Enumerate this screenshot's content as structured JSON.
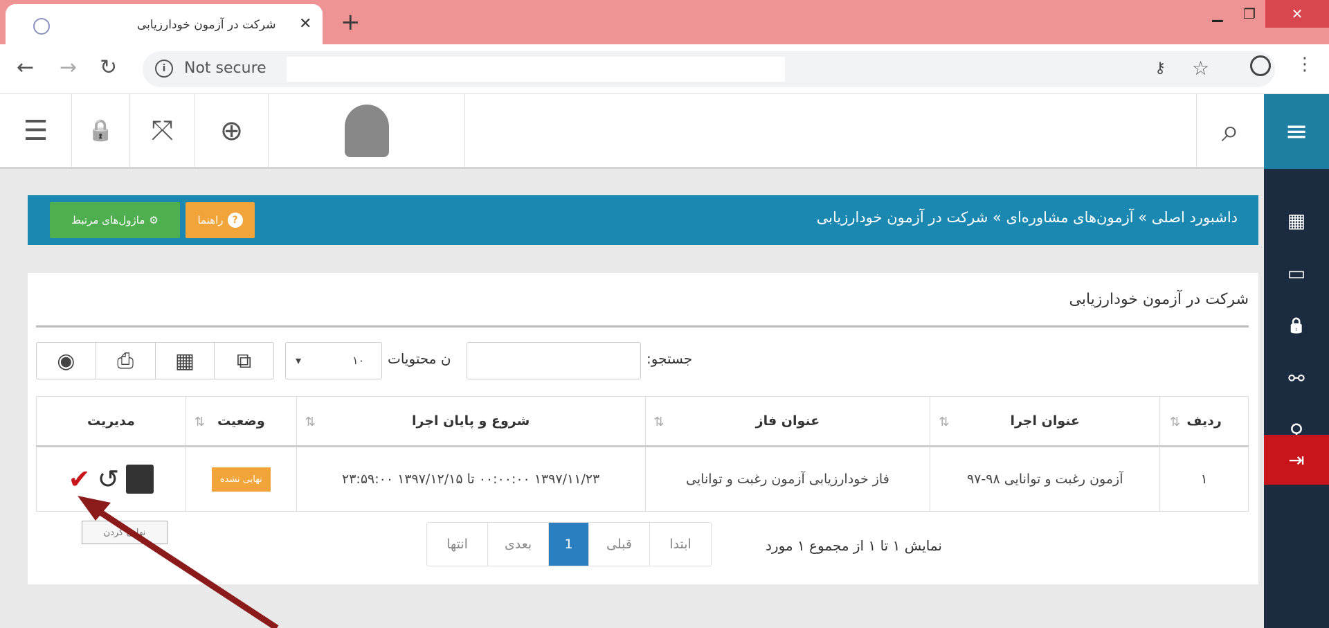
{
  "browser": {
    "tab_title": "شرکت در آزمون خودارزیابی",
    "tab_close": "✕",
    "new_tab": "+",
    "win_min": "▁",
    "win_max": "❐",
    "win_close": "✕",
    "nav_back": "←",
    "nav_forward": "→",
    "nav_reload": "↻",
    "info_glyph": "i",
    "security_text": "Not secure",
    "key_glyph": "⚷",
    "star_glyph": "☆",
    "menu_glyph": "⋮"
  },
  "header": {
    "icons": [
      "list-icon",
      "lock-icon",
      "fullscreen-icon",
      "help-lifebuoy-icon",
      "avatar",
      "search-icon"
    ],
    "list_glyph": "☰",
    "lock_glyph": "🔒",
    "fullscreen_glyph": "⤧",
    "help_glyph": "⊕",
    "search_glyph": "⌕"
  },
  "sidebar": {
    "menu_glyph": "≡",
    "items": [
      {
        "icon": "grid-icon",
        "glyph": "▦"
      },
      {
        "icon": "monitor-icon",
        "glyph": "▭"
      },
      {
        "icon": "lock-icon",
        "glyph": "🔒"
      },
      {
        "icon": "link-icon",
        "glyph": "⚯"
      },
      {
        "icon": "bulb-icon",
        "glyph": "♀"
      },
      {
        "icon": "exit-icon",
        "glyph": "⇥"
      }
    ],
    "exit_color": "#c8151b"
  },
  "breadcrumb": {
    "text": "داشبورد اصلی » آزمون‌های مشاوره‌ای » شرکت در آزمون خودارزیابی",
    "help_label": "راهنما",
    "help_glyph": "?",
    "modules_label": "ماژول‌های مرتبط",
    "modules_glyph": "⚙"
  },
  "panel": {
    "title": "شرکت در آزمون خودارزیابی",
    "search_label": "جستجو:",
    "length_label": "ن محتویات",
    "length_value": "۱۰",
    "length_caret": "▾",
    "tools": [
      {
        "name": "copy-icon",
        "glyph": "⧉"
      },
      {
        "name": "table-icon",
        "glyph": "▦"
      },
      {
        "name": "print-icon",
        "glyph": "⎙"
      },
      {
        "name": "visibility-icon",
        "glyph": "◉"
      }
    ]
  },
  "table": {
    "sort_glyph": "⇅",
    "headers": [
      "ردیف",
      "عنوان اجرا",
      "عنوان فاز",
      "شروع و پایان اجرا",
      "وضعیت",
      "مدیریت"
    ],
    "rows": [
      {
        "index": "۱",
        "run_title": "آزمون رغبت و توانایی ۹۸-۹۷",
        "phase_title": "فاز خودارزیابی آزمون رغبت و توانایی",
        "period": "۱۳۹۷/۱۱/۲۳ ۰۰:۰۰:۰۰ تا ۱۳۹۷/۱۲/۱۵ ۲۳:۵۹:۰۰",
        "status": "نهایی نشده",
        "check_glyph": "✔",
        "history_glyph": "↺"
      }
    ]
  },
  "tooltip": "نهایی کردن",
  "pagination": {
    "info": "نمایش ۱ تا ۱ از مجموع ۱ مورد",
    "first": "ابتدا",
    "prev": "قبلی",
    "current": "1",
    "next": "بعدی",
    "last": "انتها"
  },
  "colors": {
    "tab_strip": "#ee9495",
    "breadcrumb_bg": "#1a88b0",
    "help_btn": "#f0a43a",
    "modules_btn": "#4fae4f",
    "status_badge": "#f0a43a",
    "page_active": "#2a7fc0",
    "annotation_arrow": "#8b1a1a"
  }
}
